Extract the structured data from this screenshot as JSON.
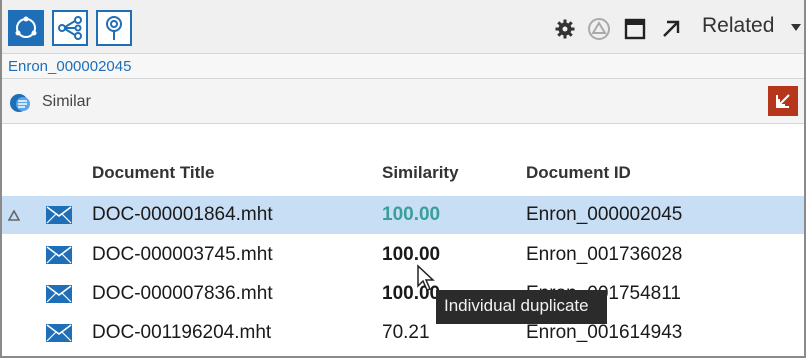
{
  "toolbar": {
    "buttons": [
      {
        "name": "refresh",
        "icon": "cycle-icon",
        "active": true
      },
      {
        "name": "share",
        "icon": "share-nodes-icon",
        "active": false
      },
      {
        "name": "location",
        "icon": "map-pin-icon",
        "active": false
      }
    ],
    "right_icons": [
      "gear-icon",
      "warning-triangle-icon",
      "maximize-window-icon",
      "arrow-up-right-icon"
    ],
    "related_label": "Related"
  },
  "breadcrumb": {
    "link": "Enron_000002045"
  },
  "section": {
    "label": "Similar",
    "icon": "similar-chat-icon",
    "expand_icon": "collapse-icon"
  },
  "table": {
    "columns": [
      "Document Title",
      "Similarity",
      "Document ID"
    ],
    "rows": [
      {
        "title": "DOC-000001864.mht",
        "similarity": "100.00",
        "doc_id": "Enron_000002045",
        "selected": true
      },
      {
        "title": "DOC-000003745.mht",
        "similarity": "100.00",
        "doc_id": "Enron_001736028",
        "selected": false
      },
      {
        "title": "DOC-000007836.mht",
        "similarity": "100.00",
        "doc_id": "Enron_001754811",
        "selected": false
      },
      {
        "title": "DOC-001196204.mht",
        "similarity": "70.21",
        "doc_id": "Enron_001614943",
        "selected": false
      }
    ]
  },
  "tooltip": {
    "text": "Individual duplicate"
  },
  "colors": {
    "accent": "#1e6fb8",
    "selected_row": "#c7def5",
    "teal": "#3a9f98",
    "expand_button": "#b5361a"
  }
}
